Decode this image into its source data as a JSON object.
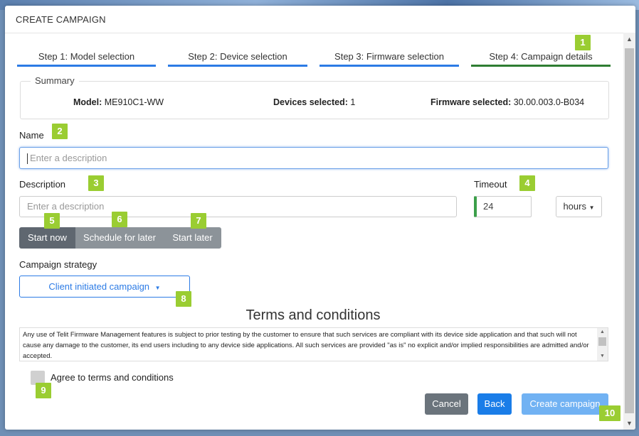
{
  "modal": {
    "title": "CREATE CAMPAIGN"
  },
  "steps": [
    {
      "label": "Step 1: Model selection"
    },
    {
      "label": "Step 2: Device selection"
    },
    {
      "label": "Step 3: Firmware selection"
    },
    {
      "label": "Step 4: Campaign details"
    }
  ],
  "summary": {
    "legend": "Summary",
    "model_label": "Model:",
    "model_value": "ME910C1-WW",
    "devices_label": "Devices selected:",
    "devices_value": "1",
    "firmware_label": "Firmware selected:",
    "firmware_value": "30.00.003.0-B034"
  },
  "form": {
    "name_label": "Name",
    "name_placeholder": "Enter a description",
    "description_label": "Description",
    "description_placeholder": "Enter a description",
    "timeout_label": "Timeout",
    "timeout_value": "24",
    "timeout_unit": "hours",
    "start_options": [
      "Start now",
      "Schedule for later",
      "Start later"
    ],
    "strategy_label": "Campaign strategy",
    "strategy_value": "Client initiated campaign"
  },
  "terms": {
    "title": "Terms and conditions",
    "text": "Any use of Telit Firmware Management features is subject to prior testing by the customer to ensure that such services are compliant with its device side application and that such will not cause any damage to the customer, its end users including to any device side applications. All such services are provided \"as is\" no explicit and/or implied responsibilities are admitted and/or accepted.",
    "agree_label": "Agree to terms and conditions"
  },
  "buttons": {
    "cancel": "Cancel",
    "back": "Back",
    "create": "Create campaign"
  },
  "badges": [
    "1",
    "2",
    "3",
    "4",
    "5",
    "6",
    "7",
    "8",
    "9",
    "10"
  ],
  "colors": {
    "accent": "#2c7be5",
    "active_step": "#2e7d32",
    "badge": "#9acd32"
  }
}
